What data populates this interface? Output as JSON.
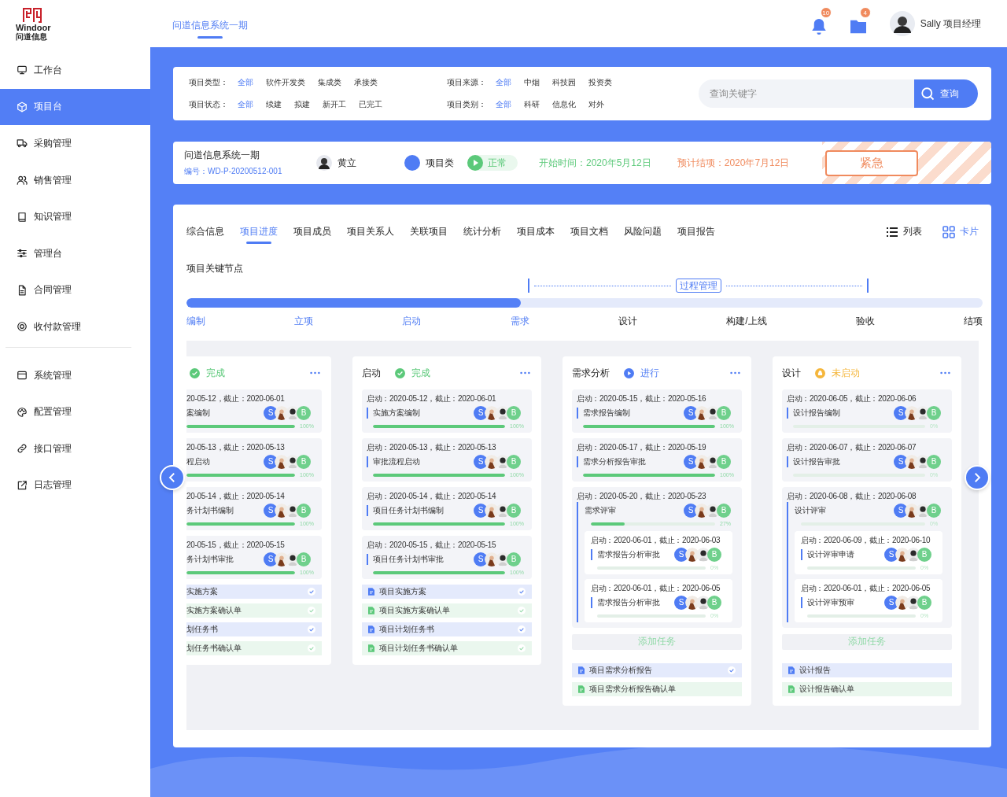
{
  "logo": {
    "name": "Windoor",
    "subtitle": "问道信息"
  },
  "header": {
    "tabs": [
      {
        "label": "问道信息系统一期",
        "selected": true
      }
    ],
    "notifications": "10",
    "messages": "4",
    "user": "Sally 项目经理"
  },
  "sidebar": [
    {
      "items": [
        {
          "label": "工作台",
          "selected": false
        },
        {
          "label": "项目台",
          "selected": true
        },
        {
          "label": "采购管理",
          "selected": false
        },
        {
          "label": "销售管理",
          "selected": false
        },
        {
          "label": "知识管理",
          "selected": false
        },
        {
          "label": "管理台",
          "selected": false
        },
        {
          "label": "合同管理",
          "selected": false
        },
        {
          "label": "收付款管理",
          "selected": false
        }
      ]
    },
    {
      "items": [
        {
          "label": "系统管理",
          "selected": false
        },
        {
          "label": "配置管理",
          "selected": false
        },
        {
          "label": "接口管理",
          "selected": false
        },
        {
          "label": "日志管理",
          "selected": false
        }
      ]
    }
  ],
  "filters": [
    {
      "label": "项目类型：",
      "options": [
        {
          "label": "全部",
          "selected": true
        },
        {
          "label": "软件开发类",
          "selected": false
        },
        {
          "label": "集成类",
          "selected": false
        },
        {
          "label": "承接类",
          "selected": false
        }
      ]
    },
    {
      "label": "项目来源：",
      "options": [
        {
          "label": "全部",
          "selected": true
        },
        {
          "label": "中烟",
          "selected": false
        },
        {
          "label": "科技园",
          "selected": false
        },
        {
          "label": "投资类",
          "selected": false
        }
      ]
    },
    {
      "label": "项目状态：",
      "options": [
        {
          "label": "全部",
          "selected": true
        },
        {
          "label": "续建",
          "selected": false
        },
        {
          "label": "拟建",
          "selected": false
        },
        {
          "label": "新开工",
          "selected": false
        },
        {
          "label": "已完工",
          "selected": false
        }
      ]
    },
    {
      "label": "项目类别：",
      "options": [
        {
          "label": "全部",
          "selected": true
        },
        {
          "label": "科研",
          "selected": false
        },
        {
          "label": "信息化",
          "selected": false
        },
        {
          "label": "对外",
          "selected": false
        }
      ]
    }
  ],
  "search": {
    "placeholder": "查询关键字",
    "button": "查询"
  },
  "project": {
    "name": "问道信息系统一期",
    "code": "编号：WD-P-20200512-001",
    "manager": "黄立",
    "category": "项目类",
    "status": "正常",
    "start": "开始时间：2020年5月12日",
    "end": "预计结项：2020年7月12日",
    "priority": "紧急"
  },
  "tabs": [
    {
      "label": "综合信息",
      "selected": false
    },
    {
      "label": "项目进度",
      "selected": true
    },
    {
      "label": "项目成员",
      "selected": false
    },
    {
      "label": "项目关系人",
      "selected": false
    },
    {
      "label": "关联项目",
      "selected": false
    },
    {
      "label": "统计分析",
      "selected": false
    },
    {
      "label": "项目成本",
      "selected": false
    },
    {
      "label": "项目文档",
      "selected": false
    },
    {
      "label": "风险问题",
      "selected": false
    },
    {
      "label": "项目报告",
      "selected": false
    }
  ],
  "views": [
    {
      "label": "列表",
      "selected": false
    },
    {
      "label": "卡片",
      "selected": true
    }
  ],
  "milestones": {
    "title": "项目关键节点",
    "phase": "过程管理",
    "level": 0.42,
    "stages": [
      {
        "label": "编制",
        "done": true,
        "in_phase": false
      },
      {
        "label": "立项",
        "done": true,
        "in_phase": false
      },
      {
        "label": "启动",
        "done": true,
        "in_phase": false
      },
      {
        "label": "需求",
        "done": true,
        "in_phase": true
      },
      {
        "label": "设计",
        "done": false,
        "in_phase": true
      },
      {
        "label": "构建/上线",
        "done": false,
        "in_phase": true
      },
      {
        "label": "验收",
        "done": false,
        "in_phase": true
      },
      {
        "label": "结项",
        "done": false,
        "in_phase": false
      }
    ]
  },
  "board": {
    "columns": [
      {
        "clipped": true,
        "status": {
          "kind": "done",
          "label": "完成"
        },
        "tasks": [
          {
            "dates": "20-05-12，截止：2020-06-01",
            "name": "案编制",
            "members": [
              "S",
              "B"
            ],
            "level": 1,
            "percent": "100%"
          },
          {
            "dates": "20-05-13，截止：2020-05-13",
            "name": "程启动",
            "members": [
              "S",
              "B"
            ],
            "level": 1,
            "percent": "100%"
          },
          {
            "dates": "20-05-14，截止：2020-05-14",
            "name": "务计划书编制",
            "members": [
              "S",
              "B"
            ],
            "level": 1,
            "percent": "100%"
          },
          {
            "dates": "20-05-15，截止：2020-05-15",
            "name": "务计划书审批",
            "members": [
              "S",
              "B"
            ],
            "level": 1,
            "percent": "100%"
          }
        ],
        "docs": [
          {
            "name": "实施方案",
            "kind": "plan",
            "checked": true
          },
          {
            "name": "实施方案确认单",
            "kind": "confirm",
            "checked": true
          },
          {
            "name": "划任务书",
            "kind": "plan",
            "checked": true
          },
          {
            "name": "划任务书确认单",
            "kind": "confirm",
            "checked": true
          }
        ]
      },
      {
        "clipped": false,
        "title": "启动",
        "status": {
          "kind": "done",
          "label": "完成"
        },
        "tasks": [
          {
            "dates": "启动：2020-05-12，截止：2020-06-01",
            "name": "实施方案编制",
            "members": [
              "S",
              "B"
            ],
            "level": 1,
            "percent": "100%"
          },
          {
            "dates": "启动：2020-05-13，截止：2020-05-13",
            "name": "审批流程启动",
            "members": [
              "S",
              "B"
            ],
            "level": 1,
            "percent": "100%"
          },
          {
            "dates": "启动：2020-05-14，截止：2020-05-14",
            "name": "项目任务计划书编制",
            "members": [
              "S",
              "B"
            ],
            "level": 1,
            "percent": "100%"
          },
          {
            "dates": "启动：2020-05-15，截止：2020-05-15",
            "name": "项目任务计划书审批",
            "members": [
              "S",
              "B"
            ],
            "level": 1,
            "percent": "100%"
          }
        ],
        "docs": [
          {
            "name": "项目实施方案",
            "kind": "plan",
            "checked": true
          },
          {
            "name": "项目实施方案确认单",
            "kind": "confirm",
            "checked": true
          },
          {
            "name": "项目计划任务书",
            "kind": "plan",
            "checked": true
          },
          {
            "name": "项目计划任务书确认单",
            "kind": "confirm",
            "checked": true
          }
        ]
      },
      {
        "clipped": false,
        "title": "需求分析",
        "status": {
          "kind": "running",
          "label": "进行"
        },
        "add_task": "添加任务",
        "tasks": [
          {
            "dates": "启动：2020-05-15，截止：2020-05-16",
            "name": "需求报告编制",
            "members": [
              "S",
              "B"
            ],
            "level": 1,
            "percent": "100%"
          },
          {
            "dates": "启动：2020-05-17，截止：2020-05-19",
            "name": "需求分析报告审批",
            "members": [
              "S",
              "B"
            ],
            "level": 1,
            "percent": "100%"
          },
          {
            "dates": "启动：2020-05-20，截止：2020-05-23",
            "name": "需求评审",
            "members": [
              "S",
              "B"
            ],
            "level": 0.27,
            "percent": "27%",
            "children": [
              {
                "dates": "启动：2020-06-01，截止：2020-06-03",
                "name": "需求报告分析审批",
                "members": [
                  "S",
                  "B"
                ],
                "level": 0,
                "percent": "0%"
              },
              {
                "dates": "启动：2020-06-01，截止：2020-06-05",
                "name": "需求报告分析审批",
                "members": [
                  "S",
                  "B"
                ],
                "level": 0,
                "percent": "0%"
              }
            ]
          }
        ],
        "docs": [
          {
            "name": "项目需求分析报告",
            "kind": "plan",
            "checked": true
          },
          {
            "name": "项目需求分析报告确认单",
            "kind": "confirm",
            "checked": false
          }
        ]
      },
      {
        "clipped": false,
        "title": "设计",
        "status": {
          "kind": "pending",
          "label": "未启动"
        },
        "add_task": "添加任务",
        "tasks": [
          {
            "dates": "启动：2020-06-05，截止：2020-06-06",
            "name": "设计报告编制",
            "members": [
              "S",
              "B"
            ],
            "level": 0,
            "percent": "0%"
          },
          {
            "dates": "启动：2020-06-07，截止：2020-06-07",
            "name": "设计报告审批",
            "members": [
              "S",
              "B"
            ],
            "level": 0,
            "percent": "0%"
          },
          {
            "dates": "启动：2020-06-08，截止：2020-06-08",
            "name": "设计评审",
            "members": [
              "S",
              "B"
            ],
            "level": 0,
            "percent": "0%",
            "children": [
              {
                "dates": "启动：2020-06-09，截止：2020-06-10",
                "name": "设计评审申请",
                "members": [
                  "S",
                  "B"
                ],
                "level": 0,
                "percent": "0%"
              },
              {
                "dates": "启动：2020-06-01，截止：2020-06-05",
                "name": "设计评审预审",
                "members": [
                  "S",
                  "B"
                ],
                "level": 0,
                "percent": "0%"
              }
            ]
          }
        ],
        "docs": [
          {
            "name": "设计报告",
            "kind": "plan",
            "checked": false
          },
          {
            "name": "设计报告确认单",
            "kind": "confirm",
            "checked": false
          }
        ]
      }
    ]
  }
}
